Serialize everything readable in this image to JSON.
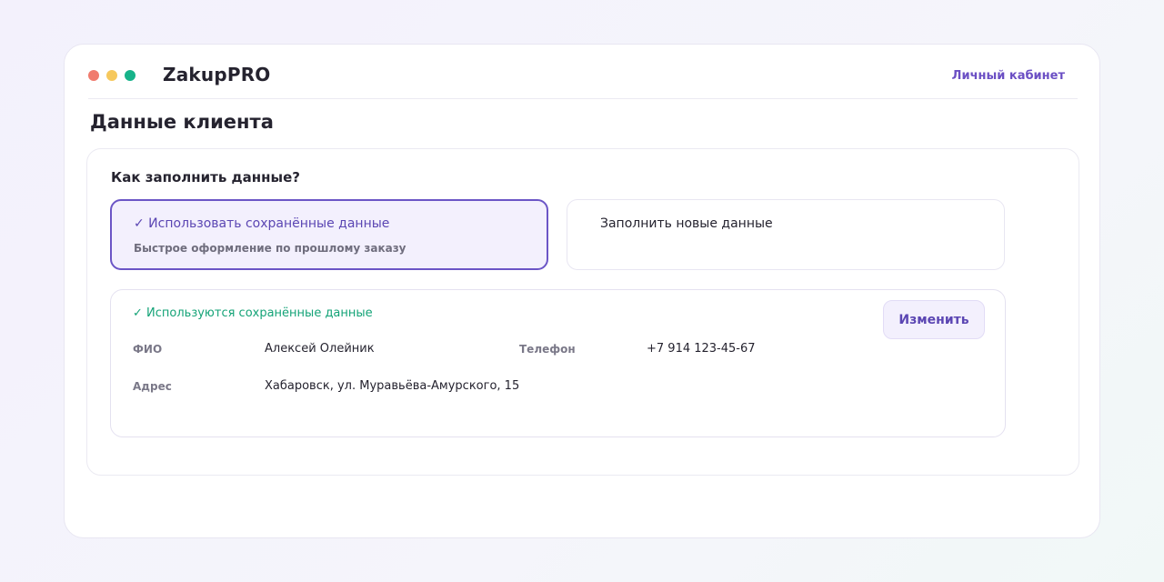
{
  "app": {
    "brand": "ZakupPRO",
    "account_link": "Личный кабинет"
  },
  "page": {
    "title": "Данные клиента"
  },
  "form": {
    "question": "Как заполнить данные?",
    "options": [
      {
        "title": "✓ Использовать сохранённые данные",
        "subtitle": "Быстрое оформление по прошлому заказу",
        "selected": true
      },
      {
        "title": "Заполнить новые данные",
        "selected": false
      }
    ]
  },
  "saved_data": {
    "status": "✓ Используются сохранённые данные",
    "edit_label": "Изменить",
    "fields": {
      "name": {
        "label": "ФИО",
        "value": "Алексей Олейник"
      },
      "phone": {
        "label": "Телефон",
        "value": "+7 914 123-45-67"
      },
      "address": {
        "label": "Адрес",
        "value": "Хабаровск, ул. Муравьёва-Амурского, 15"
      }
    }
  },
  "colors": {
    "accent": "#6b55c6",
    "success": "#14a377",
    "window_dot_red": "#f07b6e",
    "window_dot_yellow": "#f6c85d",
    "window_dot_green": "#17b38a"
  }
}
